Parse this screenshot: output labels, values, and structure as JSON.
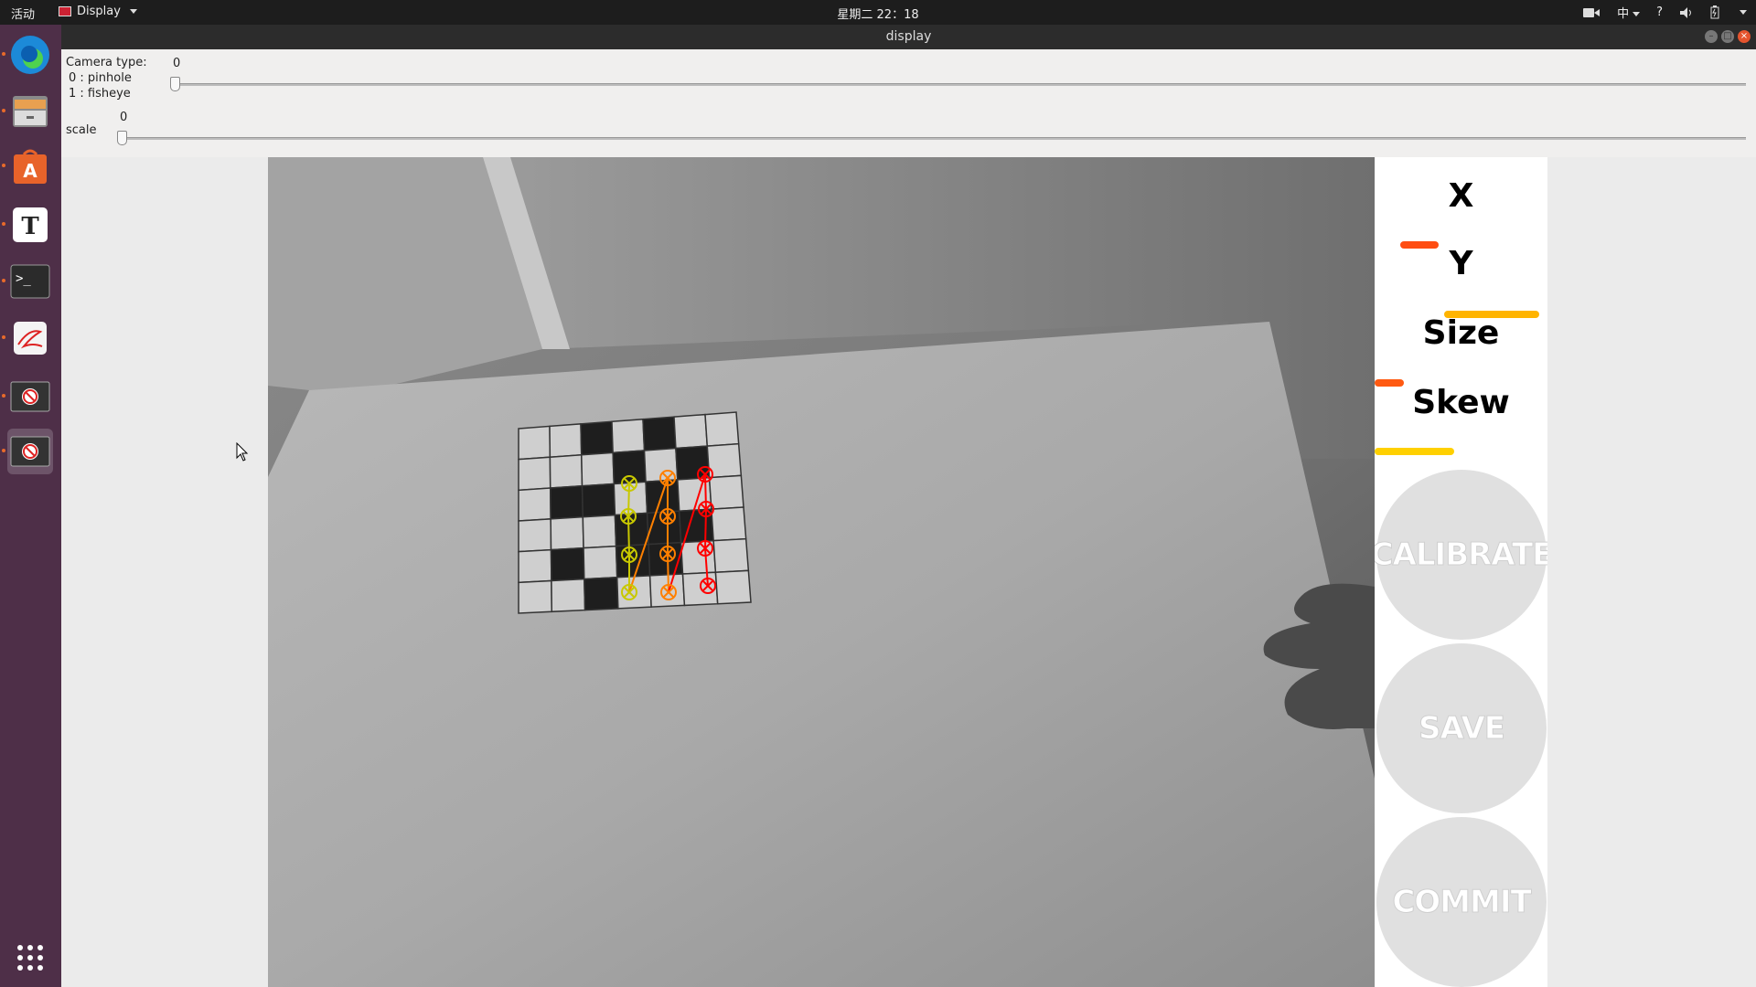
{
  "topbar": {
    "activities": "活动",
    "app_menu": "Display",
    "clock": "星期二 22：18",
    "input_method": "中",
    "help": "?"
  },
  "dock": {
    "items": [
      {
        "icon": "edge-browser-icon"
      },
      {
        "icon": "file-manager-icon"
      },
      {
        "icon": "software-center-icon"
      },
      {
        "icon": "text-editor-icon"
      },
      {
        "icon": "terminal-icon"
      },
      {
        "icon": "pdf-viewer-icon"
      },
      {
        "icon": "display-window-icon"
      },
      {
        "icon": "display-window-icon"
      }
    ],
    "show_apps_icon": "app-grid-icon"
  },
  "window": {
    "title": "display"
  },
  "controls": {
    "camera_type": {
      "label_line1": "Camera type:",
      "label_line2": "0 : pinhole",
      "label_line3": "1 : fisheye",
      "value": "0",
      "level": 0
    },
    "scale": {
      "label": "scale",
      "value": "0",
      "level": 0
    }
  },
  "side_panel": {
    "labels": {
      "x": "X",
      "y": "Y",
      "size": "Size",
      "skew": "Skew"
    },
    "progress": {
      "x": {
        "color": "#ff4d12",
        "start": 0.15,
        "end": 0.37
      },
      "y": {
        "color": "#ffb400",
        "start": 0.4,
        "end": 0.95
      },
      "size": {
        "color": "#ff5a12",
        "start": 0.0,
        "end": 0.17
      },
      "skew": {
        "color": "#ffd000",
        "start": 0.0,
        "end": 0.46
      }
    },
    "buttons": {
      "calibrate": "CALIBRATE",
      "save": "SAVE",
      "commit": "COMMIT"
    }
  },
  "colors": {
    "corner_row_yellow": "#c8c800",
    "corner_row_orange": "#ff8000",
    "corner_row_red": "#ff0000"
  }
}
